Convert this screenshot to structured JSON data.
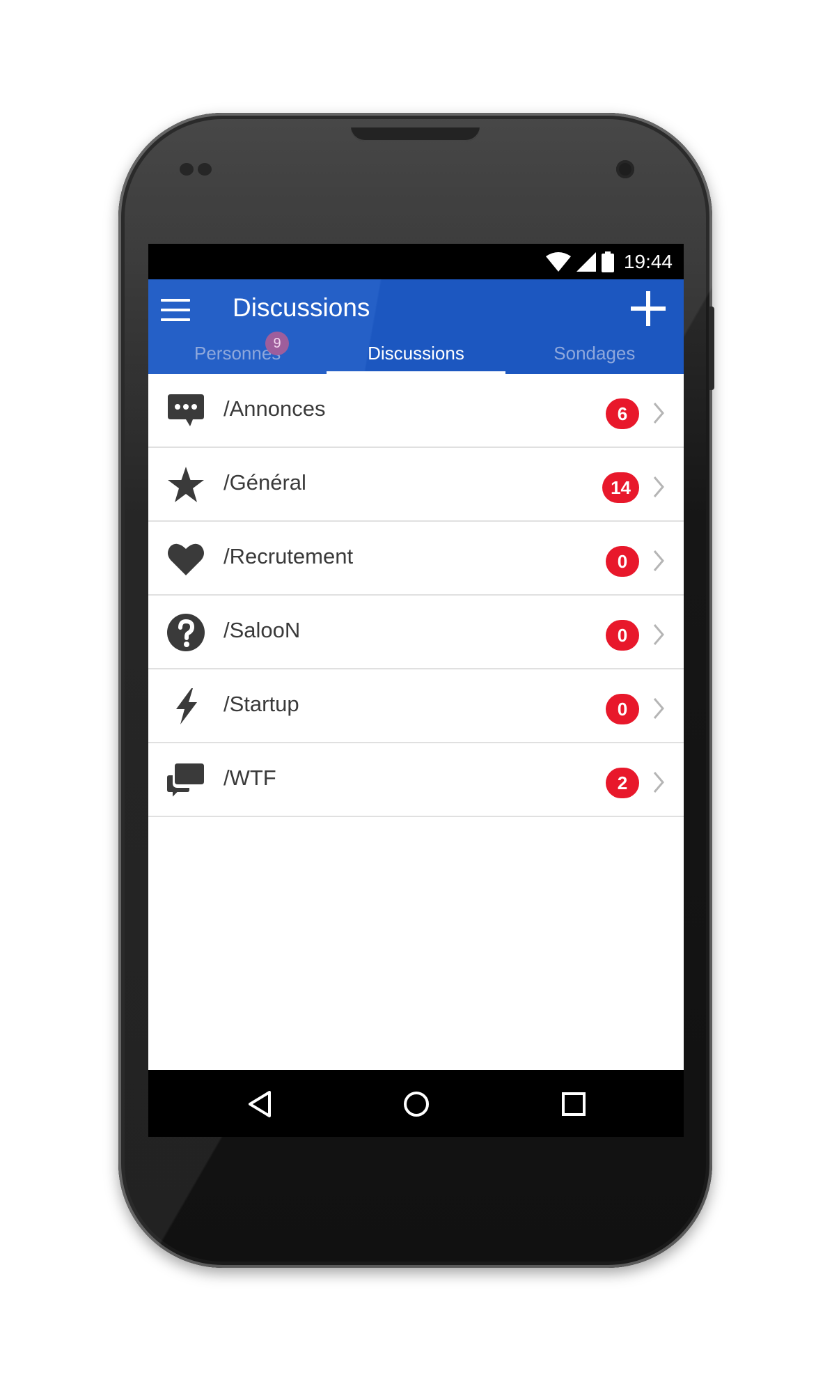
{
  "status_bar": {
    "time": "19:44"
  },
  "app_bar": {
    "title": "Discussions"
  },
  "tabs": [
    {
      "label": "Personnes",
      "badge": "9"
    },
    {
      "label": "Discussions"
    },
    {
      "label": "Sondages"
    }
  ],
  "channels": [
    {
      "name": "/Annonces",
      "icon": "chat-bubble-dots-icon",
      "count": "6"
    },
    {
      "name": "/Général",
      "icon": "star-icon",
      "count": "14"
    },
    {
      "name": "/Recrutement",
      "icon": "heart-icon",
      "count": "0"
    },
    {
      "name": "/SalooN",
      "icon": "question-circle-icon",
      "count": "0"
    },
    {
      "name": "/Startup",
      "icon": "lightning-bolt-icon",
      "count": "0"
    },
    {
      "name": "/WTF",
      "icon": "chat-bubbles-icon",
      "count": "2"
    }
  ],
  "colors": {
    "app_bar": "#2560c7",
    "badge": "#e8182b",
    "icon": "#3a3a3a"
  }
}
